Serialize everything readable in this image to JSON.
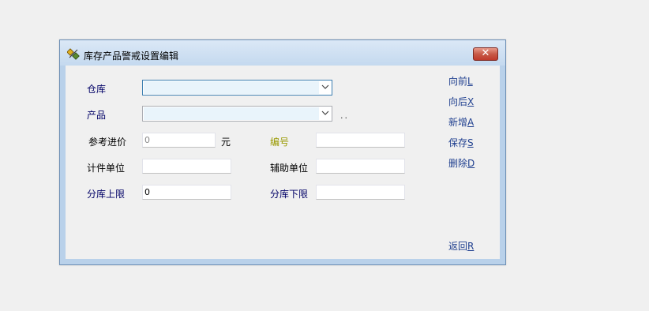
{
  "window": {
    "title": "库存产品警戒设置编辑",
    "close_glyph": "✕"
  },
  "form": {
    "warehouse": {
      "label": "仓库",
      "value": ""
    },
    "product": {
      "label": "产品",
      "value": "",
      "more_glyph": ".."
    },
    "ref_price": {
      "label": "参考进价",
      "value": "0",
      "unit": "元"
    },
    "code": {
      "label": "编号",
      "value": ""
    },
    "unit": {
      "label": "计件单位",
      "value": ""
    },
    "aux_unit": {
      "label": "辅助单位",
      "value": ""
    },
    "upper_limit": {
      "label": "分库上限",
      "value": "0"
    },
    "lower_limit": {
      "label": "分库下限",
      "value": ""
    }
  },
  "actions": {
    "prev": {
      "label": "向前",
      "key": "L"
    },
    "next": {
      "label": "向后",
      "key": "X"
    },
    "add": {
      "label": "新增",
      "key": "A"
    },
    "save": {
      "label": "保存",
      "key": "S"
    },
    "delete": {
      "label": "删除",
      "key": "D"
    },
    "back": {
      "label": "返回",
      "key": "R"
    }
  },
  "colors": {
    "label": "#000066",
    "link": "#1f3f8f",
    "code_label": "#999900",
    "window_frame": "#b9d1ea",
    "close_button": "#c75a48"
  },
  "icons": {
    "app": "pencil-tools-icon",
    "close": "close-icon",
    "dropdown": "chevron-down-icon"
  }
}
